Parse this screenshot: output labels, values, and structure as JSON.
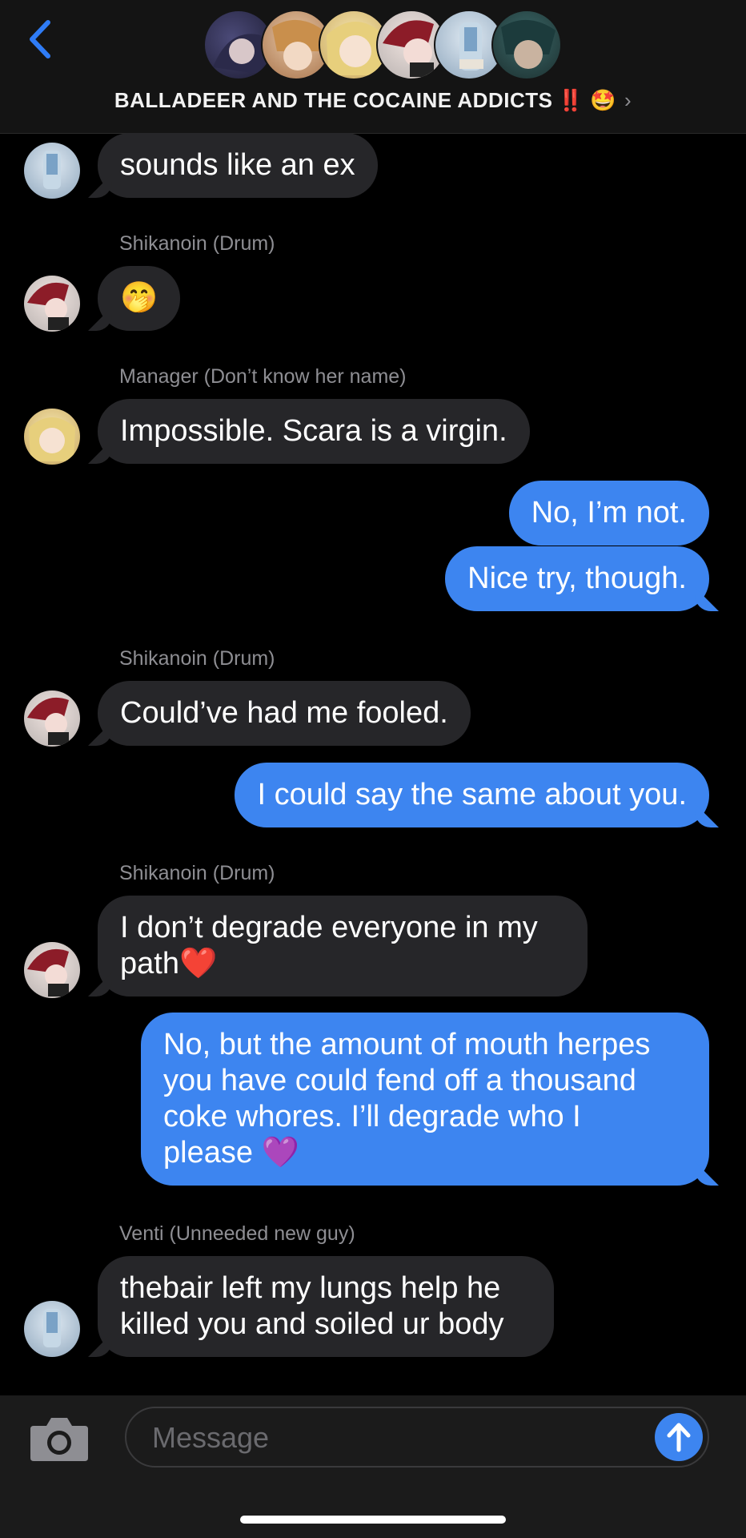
{
  "header": {
    "title": "BALLADEER AND THE COCAINE ADDICTS",
    "title_emoji": "‼️ 🤩",
    "chevron": "›"
  },
  "messages": [
    {
      "side": "in",
      "sender": "",
      "avatar": "venti",
      "text": "sounds like an ex"
    },
    {
      "side": "in",
      "sender": "Shikanoin (Drum)",
      "avatar": "shikanoin",
      "text": "🤭"
    },
    {
      "side": "in",
      "sender": "Manager (Don’t know her name)",
      "avatar": "manager",
      "text": "Impossible. Scara is a virgin."
    },
    {
      "side": "out",
      "sender": "",
      "text": "No, I’m not."
    },
    {
      "side": "out",
      "sender": "",
      "text": "Nice try, though."
    },
    {
      "side": "in",
      "sender": "Shikanoin (Drum)",
      "avatar": "shikanoin",
      "text": "Could’ve had me fooled."
    },
    {
      "side": "out",
      "sender": "",
      "text": "I could say the same about you."
    },
    {
      "side": "in",
      "sender": "Shikanoin (Drum)",
      "avatar": "shikanoin",
      "text_lines": [
        "I don’t degrade everyone in my",
        "path❤️"
      ]
    },
    {
      "side": "out",
      "sender": "",
      "text_lines": [
        "No, but the amount of mouth herpes",
        "you have could fend off a thousand",
        "coke whores. I’ll degrade who I",
        "please 💜"
      ]
    },
    {
      "side": "in",
      "sender": "Venti (Unneeded new guy)",
      "avatar": "venti",
      "text_lines": [
        "thebair left my lungs help he",
        "killed you and soiled ur body"
      ]
    }
  ],
  "composer": {
    "placeholder": "Message"
  },
  "colors": {
    "accent_blue": "#3d85f0",
    "incoming_bubble": "#262629",
    "background": "#000000",
    "header_bg": "#141414"
  },
  "icons": {
    "back": "chevron-left-icon",
    "camera": "camera-icon",
    "send": "arrow-up-icon"
  }
}
